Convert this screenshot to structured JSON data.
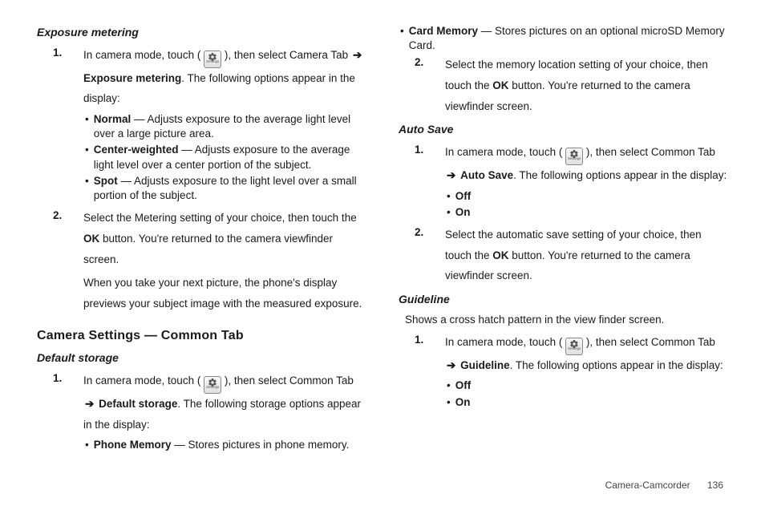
{
  "left": {
    "exposure_heading": "Exposure metering",
    "step1_pre": "In camera mode, touch (",
    "step1_post": "), then select Camera Tab",
    "arrow": "➔",
    "step1_bold": "Exposure metering",
    "step1_tail": ". The following options appear in the display:",
    "bullets": [
      {
        "bold": "Normal",
        "rest": " — Adjusts exposure to the average light level over a large picture area."
      },
      {
        "bold": "Center-weighted",
        "rest": " — Adjusts exposure to the average light level over a center portion of the subject."
      },
      {
        "bold": "Spot",
        "rest": " — Adjusts exposure to the light level over a small portion of the subject."
      }
    ],
    "step2_a": "Select the Metering setting of your choice, then touch the ",
    "step2_bold": "OK",
    "step2_b": " button. You're returned to the camera viewfinder screen.",
    "step2_extra": "When you take your next picture, the phone's display previews your subject image with the measured exposure.",
    "common_heading": "Camera Settings — Common Tab",
    "default_storage_heading": "Default storage",
    "ds1_pre": "In camera mode, touch (",
    "ds1_post": "), then select Common Tab",
    "ds1_bold": "Default storage",
    "ds1_tail": ". The following storage options appear in the display:",
    "ds_bullets": [
      {
        "bold": "Phone Memory",
        "rest": " — Stores pictures in phone memory."
      }
    ]
  },
  "right": {
    "card_bullets": [
      {
        "bold": "Card Memory",
        "rest": " — Stores pictures on an optional microSD Memory Card."
      }
    ],
    "ds2_a": "Select the memory location setting of your choice, then touch the ",
    "ds2_bold": "OK",
    "ds2_b": " button. You're returned to the camera viewfinder screen.",
    "autosave_heading": "Auto Save",
    "as1_pre": "In camera mode, touch (",
    "as1_post": "), then select Common Tab",
    "as1_bold": "Auto Save",
    "as1_tail": ". The following options appear in the display:",
    "as_bullets": [
      {
        "bold": "Off",
        "rest": ""
      },
      {
        "bold": "On",
        "rest": ""
      }
    ],
    "as2_a": "Select the automatic save setting of your choice, then touch the ",
    "as2_bold": "OK",
    "as2_b": " button. You're returned to the camera viewfinder screen.",
    "guideline_heading": "Guideline",
    "guideline_intro": "Shows a cross hatch pattern in the view finder screen.",
    "gl1_pre": "In camera mode, touch (",
    "gl1_post": "), then select Common Tab",
    "gl1_bold": "Guideline",
    "gl1_tail": ". The following options appear in the display:",
    "gl_bullets": [
      {
        "bold": "Off",
        "rest": ""
      },
      {
        "bold": "On",
        "rest": ""
      }
    ]
  },
  "footer": {
    "section": "Camera-Camcorder",
    "page": "136"
  },
  "gear_sub": "Settings"
}
